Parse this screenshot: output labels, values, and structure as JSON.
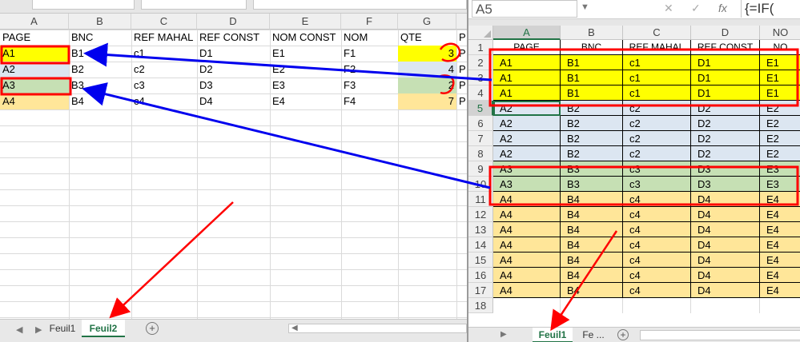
{
  "left": {
    "columns": [
      "A",
      "B",
      "C",
      "D",
      "E",
      "F",
      "G"
    ],
    "rows": [
      [
        "PAGE",
        "BNC",
        "REF MAHAL",
        "REF CONST",
        "NOM CONST",
        "NOM",
        "QTE",
        "P"
      ],
      [
        "A1",
        "B1",
        "c1",
        "D1",
        "E1",
        "F1",
        "3",
        "P"
      ],
      [
        "A2",
        "B2",
        "c2",
        "D2",
        "E2",
        "F2",
        "4",
        "P"
      ],
      [
        "A3",
        "B3",
        "c3",
        "D3",
        "E3",
        "F3",
        "2",
        "P"
      ],
      [
        "A4",
        "B4",
        "c4",
        "D4",
        "E4",
        "F4",
        "7",
        "P"
      ]
    ],
    "tabs": {
      "prev_nav": "◀",
      "next_nav": "▶",
      "sheet1": "Feuil1",
      "sheet2": "Feuil2",
      "add": "+",
      "scroll_left": "◀"
    }
  },
  "right": {
    "name_box": "A5",
    "name_box_arrow": "▼",
    "cancel_icon": "✕",
    "enter_icon": "✓",
    "fx_icon": "fx",
    "formula": "{=IF(",
    "columns": [
      "A",
      "B",
      "C",
      "D",
      "NO"
    ],
    "row_numbers": [
      "1",
      "2",
      "3",
      "4",
      "5",
      "6",
      "7",
      "8",
      "9",
      "10",
      "11",
      "12",
      "13",
      "14",
      "15",
      "16",
      "17",
      "18"
    ],
    "rows": [
      [
        "PAGE",
        "BNC",
        "REF MAHAL",
        "REF CONST",
        "NO"
      ],
      [
        "A1",
        "B1",
        "c1",
        "D1",
        "E1"
      ],
      [
        "A1",
        "B1",
        "c1",
        "D1",
        "E1"
      ],
      [
        "A1",
        "B1",
        "c1",
        "D1",
        "E1"
      ],
      [
        "A2",
        "B2",
        "c2",
        "D2",
        "E2"
      ],
      [
        "A2",
        "B2",
        "c2",
        "D2",
        "E2"
      ],
      [
        "A2",
        "B2",
        "c2",
        "D2",
        "E2"
      ],
      [
        "A2",
        "B2",
        "c2",
        "D2",
        "E2"
      ],
      [
        "A3",
        "B3",
        "c3",
        "D3",
        "E3"
      ],
      [
        "A3",
        "B3",
        "c3",
        "D3",
        "E3"
      ],
      [
        "A4",
        "B4",
        "c4",
        "D4",
        "E4"
      ],
      [
        "A4",
        "B4",
        "c4",
        "D4",
        "E4"
      ],
      [
        "A4",
        "B4",
        "c4",
        "D4",
        "E4"
      ],
      [
        "A4",
        "B4",
        "c4",
        "D4",
        "E4"
      ],
      [
        "A4",
        "B4",
        "c4",
        "D4",
        "E4"
      ],
      [
        "A4",
        "B4",
        "c4",
        "D4",
        "E4"
      ],
      [
        "A4",
        "B4",
        "c4",
        "D4",
        "E4"
      ]
    ],
    "tabs": {
      "next_nav": "▶",
      "sheet1": "Feuil1",
      "sheet2": "Fe ...",
      "add": "+"
    }
  },
  "colors": {
    "yellow": "#ffff00",
    "blue": "#dce6f1",
    "green": "#c6e0b4",
    "orange": "#ffe699",
    "annotation_red": "#ff0000",
    "annotation_blue": "#0000ee",
    "excel_green": "#217346"
  }
}
